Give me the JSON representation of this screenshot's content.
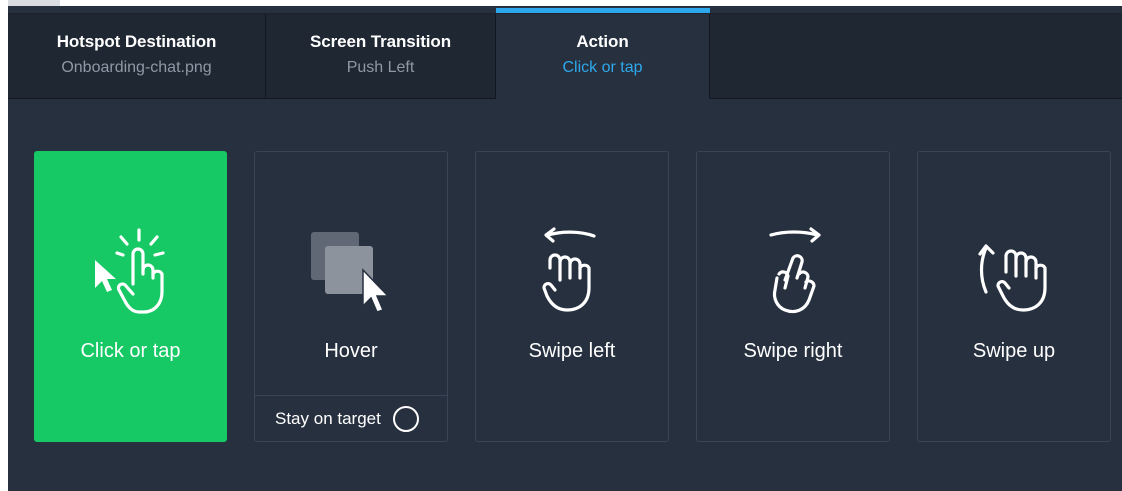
{
  "tabs": [
    {
      "title": "Hotspot Destination",
      "value": "Onboarding-chat.png",
      "active": false
    },
    {
      "title": "Screen Transition",
      "value": "Push Left",
      "active": false
    },
    {
      "title": "Action",
      "value": "Click or tap",
      "active": true
    }
  ],
  "actions": [
    {
      "label": "Click or tap",
      "icon": "click-tap-hand-icon",
      "selected": true
    },
    {
      "label": "Hover",
      "icon": "hover-cursor-icon",
      "selected": false,
      "option_label": "Stay on target",
      "option_checked": false
    },
    {
      "label": "Swipe left",
      "icon": "swipe-left-hand-icon",
      "selected": false
    },
    {
      "label": "Swipe right",
      "icon": "swipe-right-hand-icon",
      "selected": false
    },
    {
      "label": "Swipe up",
      "icon": "swipe-up-hand-icon",
      "selected": false
    }
  ],
  "colors": {
    "background": "#27303f",
    "tabbar": "#1f2733",
    "accent": "#2ea8ec",
    "selected": "#17c964",
    "border": "#3b4454",
    "muted_text": "#8f98a4"
  }
}
